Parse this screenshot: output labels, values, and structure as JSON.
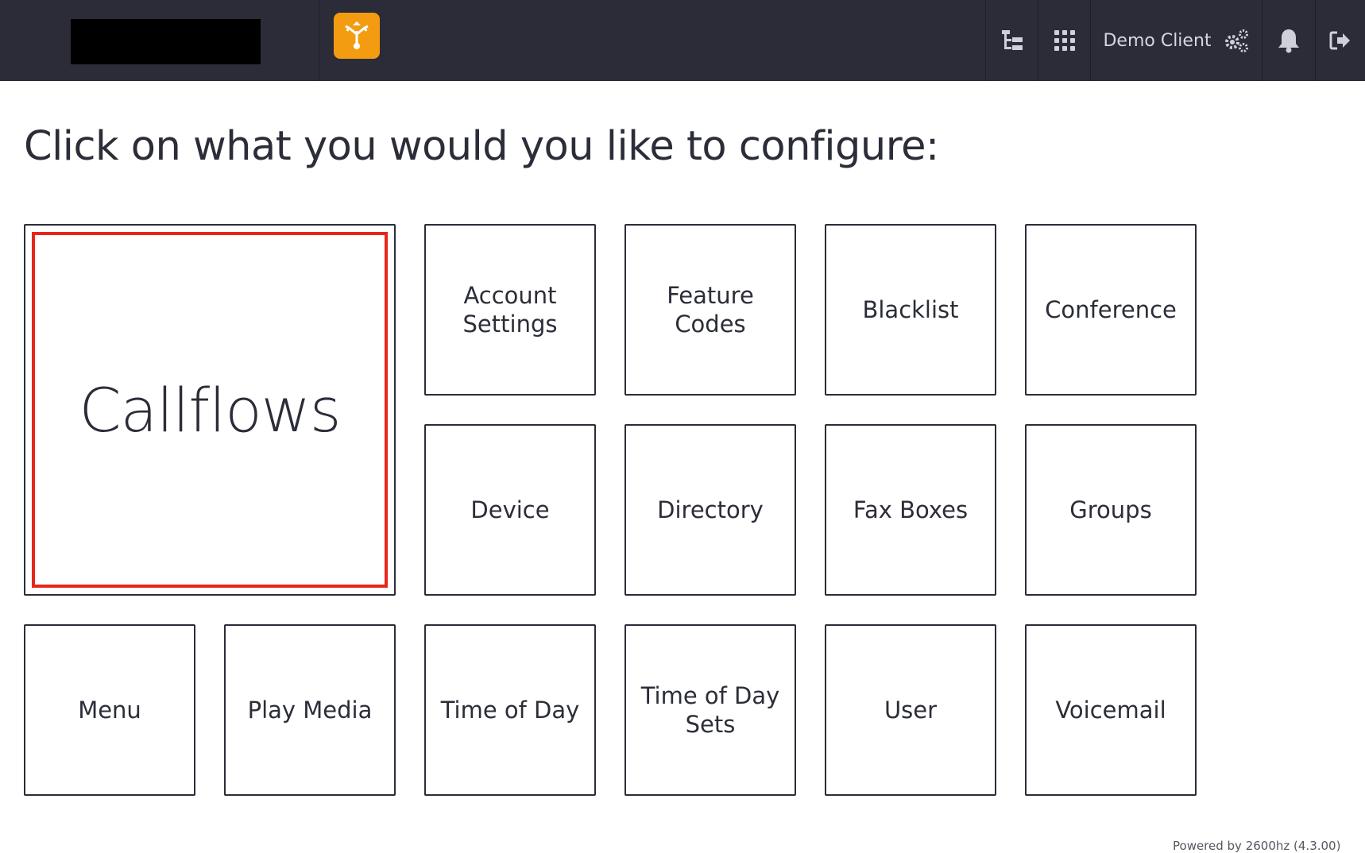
{
  "header": {
    "client_name": "Demo Client",
    "icons": {
      "app": "callflow-app-icon",
      "tree": "account-tree-icon",
      "apps": "app-grid-icon",
      "settings": "gears-icon",
      "notifications": "bell-icon",
      "logout": "sign-out-icon"
    },
    "accent_color": "#f39c12",
    "background_color": "#2b2c38"
  },
  "main": {
    "title": "Click on what you would you like to configure:",
    "featured": {
      "label": "Callflows",
      "highlight_color": "#e7261b"
    },
    "tiles": [
      {
        "id": "account-settings",
        "label": "Account\nSettings"
      },
      {
        "id": "feature-codes",
        "label": "Feature\nCodes"
      },
      {
        "id": "blacklist",
        "label": "Blacklist"
      },
      {
        "id": "conference",
        "label": "Conference"
      },
      {
        "id": "device",
        "label": "Device"
      },
      {
        "id": "directory",
        "label": "Directory"
      },
      {
        "id": "fax-boxes",
        "label": "Fax Boxes"
      },
      {
        "id": "groups",
        "label": "Groups"
      },
      {
        "id": "menu",
        "label": "Menu"
      },
      {
        "id": "play-media",
        "label": "Play Media"
      },
      {
        "id": "time-of-day",
        "label": "Time of Day"
      },
      {
        "id": "time-of-day-sets",
        "label": "Time of Day\nSets"
      },
      {
        "id": "user",
        "label": "User"
      },
      {
        "id": "voicemail",
        "label": "Voicemail"
      }
    ]
  },
  "footer": {
    "text": "Powered by 2600hz (4.3.00)"
  }
}
